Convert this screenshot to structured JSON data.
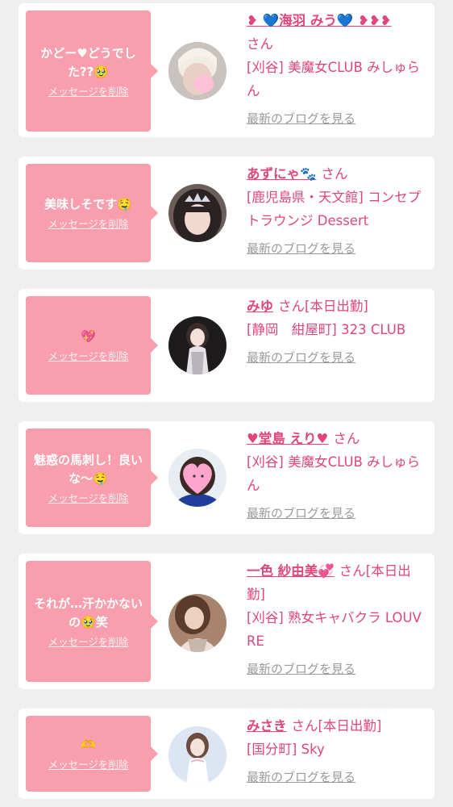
{
  "messages": [
    {
      "message": "かどー♥どうでした??🥹",
      "delete_label": "メッセージを削除",
      "name": "❥ 💙海羽 みう💙 ❥❥❥",
      "suffix": "さん",
      "shop": "[刈谷] 美魔女CLUB みしゅらん",
      "blog_link": "最新のブログを見る",
      "avatar_icon": "blonde-avatar"
    },
    {
      "message": "美味しそです🤤",
      "delete_label": "メッセージを削除",
      "name": "あずにゃ🐾",
      "suffix": "さん",
      "shop": "[鹿児島県・天文館] コンセプトラウンジ Dessert",
      "blog_link": "最新のブログを見る",
      "avatar_icon": "tiara-avatar"
    },
    {
      "message": "💖",
      "delete_label": "メッセージを削除",
      "name": "みゆ",
      "suffix": "さん[本日出勤]",
      "shop": "[静岡　紺屋町] 323 CLUB",
      "blog_link": "最新のブログを見る",
      "avatar_icon": "dress-avatar"
    },
    {
      "message": "魅惑の馬刺し！良いな〜🤤",
      "delete_label": "メッセージを削除",
      "name": "♥堂島 えり♥",
      "suffix": "さん",
      "shop": "[刈谷] 美魔女CLUB みしゅらん",
      "blog_link": "最新のブログを見る",
      "avatar_icon": "heart-face-avatar"
    },
    {
      "message": "それが…汗かかないの🥹笑",
      "delete_label": "メッセージを削除",
      "name": "一色 紗由美💞",
      "suffix": "さん[本日出勤]",
      "shop": "[刈谷] 熟女キャバクラ LOUVRE",
      "blog_link": "最新のブログを見る",
      "avatar_icon": "lace-avatar"
    },
    {
      "message": "🫶",
      "delete_label": "メッセージを削除",
      "name": "みさき",
      "suffix": "さん[本日出勤]",
      "shop": "[国分町] Sky",
      "blog_link": "最新のブログを見る",
      "avatar_icon": "white-dress-avatar"
    }
  ],
  "colors": {
    "bubble": "#f89eac",
    "name": "#e0467c",
    "link": "#9a9a9a",
    "background": "#efefef"
  }
}
